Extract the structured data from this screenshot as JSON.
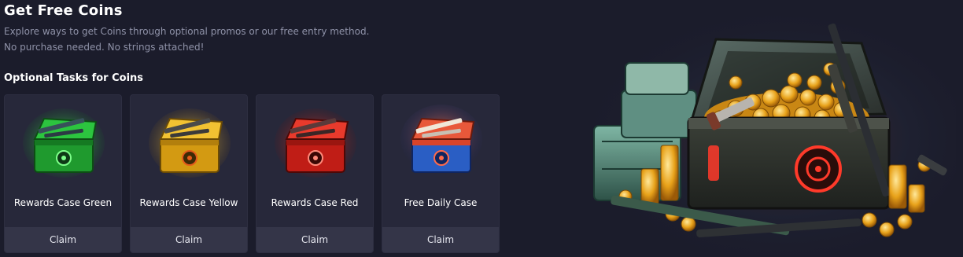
{
  "header": {
    "title": "Get Free Coins",
    "description_line1": "Explore ways to get Coins through optional promos or our free entry method.",
    "description_line2": "No purchase needed. No strings attached!"
  },
  "tasks": {
    "section_title": "Optional Tasks for Coins",
    "items": [
      {
        "label": "Rewards Case Green",
        "button": "Claim",
        "color": "#27d14a",
        "icon": "green-case-icon"
      },
      {
        "label": "Rewards Case Yellow",
        "button": "Claim",
        "color": "#f0b020",
        "icon": "yellow-case-icon"
      },
      {
        "label": "Rewards Case Red",
        "button": "Claim",
        "color": "#e0281e",
        "icon": "red-case-icon"
      },
      {
        "label": "Free Daily Case",
        "button": "Claim",
        "color": "#2f6fd6",
        "icon": "daily-case-icon"
      }
    ]
  },
  "hero": {
    "icon": "treasure-chest-coins-icon"
  },
  "colors": {
    "background": "#1b1c2b",
    "card": "#27283a",
    "button": "#343548",
    "muted_text": "#8f92a8"
  }
}
